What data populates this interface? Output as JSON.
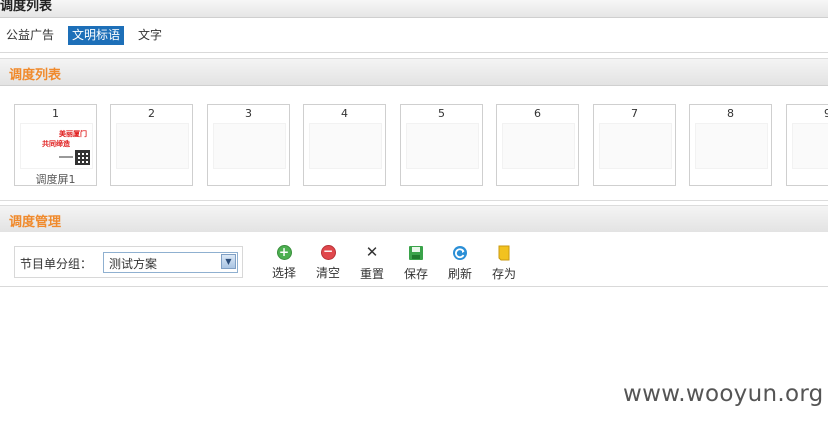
{
  "page": {
    "title": "调度列表"
  },
  "tabs": [
    {
      "label": "公益广告",
      "active": false
    },
    {
      "label": "文明标语",
      "active": true
    },
    {
      "label": "文字",
      "active": false
    }
  ],
  "schedule_section": {
    "title": "调度列表"
  },
  "screens": [
    {
      "number": "1",
      "caption": "调度屏1",
      "ad_line1": "美丽厦门",
      "ad_line2": "共同缔造"
    },
    {
      "number": "2",
      "caption": ""
    },
    {
      "number": "3",
      "caption": ""
    },
    {
      "number": "4",
      "caption": ""
    },
    {
      "number": "5",
      "caption": ""
    },
    {
      "number": "6",
      "caption": ""
    },
    {
      "number": "7",
      "caption": ""
    },
    {
      "number": "8",
      "caption": ""
    },
    {
      "number": "9",
      "caption": ""
    }
  ],
  "management_section": {
    "title": "调度管理"
  },
  "group": {
    "label": "节目单分组：",
    "selected": "测试方案"
  },
  "toolbar": {
    "select_label": "选择",
    "clear_label": "清空",
    "reset_label": "重置",
    "save_label": "保存",
    "refresh_label": "刷新",
    "saveas_label": "存为"
  },
  "colors": {
    "accent": "#f08a2c",
    "tab_active": "#1d6fb8"
  },
  "watermark": "www.wooyun.org"
}
